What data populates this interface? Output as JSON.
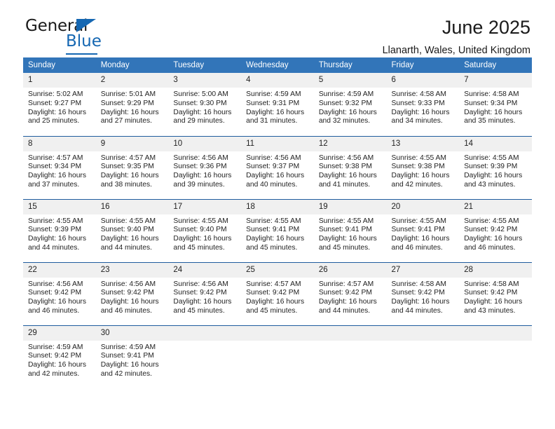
{
  "logo": {
    "word_one": "General",
    "word_two": "Blue",
    "icon": "triangle-icon"
  },
  "header": {
    "title": "June 2025",
    "location": "Llanarth, Wales, United Kingdom"
  },
  "calendar": {
    "weekday_headers": [
      "Sunday",
      "Monday",
      "Tuesday",
      "Wednesday",
      "Thursday",
      "Friday",
      "Saturday"
    ],
    "labels": {
      "sunrise": "Sunrise:",
      "sunset": "Sunset:",
      "daylight": "Daylight:"
    },
    "colors": {
      "header_background": "#3275b9",
      "row_divider": "#1f5c9e",
      "day_number_background": "#f0f0f0",
      "text": "#222222",
      "brand_blue": "#1567b2"
    },
    "weeks": [
      [
        {
          "day": "1",
          "sunrise": "Sunrise: 5:02 AM",
          "sunset": "Sunset: 9:27 PM",
          "daylight_line1": "Daylight: 16 hours",
          "daylight_line2": "and 25 minutes."
        },
        {
          "day": "2",
          "sunrise": "Sunrise: 5:01 AM",
          "sunset": "Sunset: 9:29 PM",
          "daylight_line1": "Daylight: 16 hours",
          "daylight_line2": "and 27 minutes."
        },
        {
          "day": "3",
          "sunrise": "Sunrise: 5:00 AM",
          "sunset": "Sunset: 9:30 PM",
          "daylight_line1": "Daylight: 16 hours",
          "daylight_line2": "and 29 minutes."
        },
        {
          "day": "4",
          "sunrise": "Sunrise: 4:59 AM",
          "sunset": "Sunset: 9:31 PM",
          "daylight_line1": "Daylight: 16 hours",
          "daylight_line2": "and 31 minutes."
        },
        {
          "day": "5",
          "sunrise": "Sunrise: 4:59 AM",
          "sunset": "Sunset: 9:32 PM",
          "daylight_line1": "Daylight: 16 hours",
          "daylight_line2": "and 32 minutes."
        },
        {
          "day": "6",
          "sunrise": "Sunrise: 4:58 AM",
          "sunset": "Sunset: 9:33 PM",
          "daylight_line1": "Daylight: 16 hours",
          "daylight_line2": "and 34 minutes."
        },
        {
          "day": "7",
          "sunrise": "Sunrise: 4:58 AM",
          "sunset": "Sunset: 9:34 PM",
          "daylight_line1": "Daylight: 16 hours",
          "daylight_line2": "and 35 minutes."
        }
      ],
      [
        {
          "day": "8",
          "sunrise": "Sunrise: 4:57 AM",
          "sunset": "Sunset: 9:34 PM",
          "daylight_line1": "Daylight: 16 hours",
          "daylight_line2": "and 37 minutes."
        },
        {
          "day": "9",
          "sunrise": "Sunrise: 4:57 AM",
          "sunset": "Sunset: 9:35 PM",
          "daylight_line1": "Daylight: 16 hours",
          "daylight_line2": "and 38 minutes."
        },
        {
          "day": "10",
          "sunrise": "Sunrise: 4:56 AM",
          "sunset": "Sunset: 9:36 PM",
          "daylight_line1": "Daylight: 16 hours",
          "daylight_line2": "and 39 minutes."
        },
        {
          "day": "11",
          "sunrise": "Sunrise: 4:56 AM",
          "sunset": "Sunset: 9:37 PM",
          "daylight_line1": "Daylight: 16 hours",
          "daylight_line2": "and 40 minutes."
        },
        {
          "day": "12",
          "sunrise": "Sunrise: 4:56 AM",
          "sunset": "Sunset: 9:38 PM",
          "daylight_line1": "Daylight: 16 hours",
          "daylight_line2": "and 41 minutes."
        },
        {
          "day": "13",
          "sunrise": "Sunrise: 4:55 AM",
          "sunset": "Sunset: 9:38 PM",
          "daylight_line1": "Daylight: 16 hours",
          "daylight_line2": "and 42 minutes."
        },
        {
          "day": "14",
          "sunrise": "Sunrise: 4:55 AM",
          "sunset": "Sunset: 9:39 PM",
          "daylight_line1": "Daylight: 16 hours",
          "daylight_line2": "and 43 minutes."
        }
      ],
      [
        {
          "day": "15",
          "sunrise": "Sunrise: 4:55 AM",
          "sunset": "Sunset: 9:39 PM",
          "daylight_line1": "Daylight: 16 hours",
          "daylight_line2": "and 44 minutes."
        },
        {
          "day": "16",
          "sunrise": "Sunrise: 4:55 AM",
          "sunset": "Sunset: 9:40 PM",
          "daylight_line1": "Daylight: 16 hours",
          "daylight_line2": "and 44 minutes."
        },
        {
          "day": "17",
          "sunrise": "Sunrise: 4:55 AM",
          "sunset": "Sunset: 9:40 PM",
          "daylight_line1": "Daylight: 16 hours",
          "daylight_line2": "and 45 minutes."
        },
        {
          "day": "18",
          "sunrise": "Sunrise: 4:55 AM",
          "sunset": "Sunset: 9:41 PM",
          "daylight_line1": "Daylight: 16 hours",
          "daylight_line2": "and 45 minutes."
        },
        {
          "day": "19",
          "sunrise": "Sunrise: 4:55 AM",
          "sunset": "Sunset: 9:41 PM",
          "daylight_line1": "Daylight: 16 hours",
          "daylight_line2": "and 45 minutes."
        },
        {
          "day": "20",
          "sunrise": "Sunrise: 4:55 AM",
          "sunset": "Sunset: 9:41 PM",
          "daylight_line1": "Daylight: 16 hours",
          "daylight_line2": "and 46 minutes."
        },
        {
          "day": "21",
          "sunrise": "Sunrise: 4:55 AM",
          "sunset": "Sunset: 9:42 PM",
          "daylight_line1": "Daylight: 16 hours",
          "daylight_line2": "and 46 minutes."
        }
      ],
      [
        {
          "day": "22",
          "sunrise": "Sunrise: 4:56 AM",
          "sunset": "Sunset: 9:42 PM",
          "daylight_line1": "Daylight: 16 hours",
          "daylight_line2": "and 46 minutes."
        },
        {
          "day": "23",
          "sunrise": "Sunrise: 4:56 AM",
          "sunset": "Sunset: 9:42 PM",
          "daylight_line1": "Daylight: 16 hours",
          "daylight_line2": "and 46 minutes."
        },
        {
          "day": "24",
          "sunrise": "Sunrise: 4:56 AM",
          "sunset": "Sunset: 9:42 PM",
          "daylight_line1": "Daylight: 16 hours",
          "daylight_line2": "and 45 minutes."
        },
        {
          "day": "25",
          "sunrise": "Sunrise: 4:57 AM",
          "sunset": "Sunset: 9:42 PM",
          "daylight_line1": "Daylight: 16 hours",
          "daylight_line2": "and 45 minutes."
        },
        {
          "day": "26",
          "sunrise": "Sunrise: 4:57 AM",
          "sunset": "Sunset: 9:42 PM",
          "daylight_line1": "Daylight: 16 hours",
          "daylight_line2": "and 44 minutes."
        },
        {
          "day": "27",
          "sunrise": "Sunrise: 4:58 AM",
          "sunset": "Sunset: 9:42 PM",
          "daylight_line1": "Daylight: 16 hours",
          "daylight_line2": "and 44 minutes."
        },
        {
          "day": "28",
          "sunrise": "Sunrise: 4:58 AM",
          "sunset": "Sunset: 9:42 PM",
          "daylight_line1": "Daylight: 16 hours",
          "daylight_line2": "and 43 minutes."
        }
      ],
      [
        {
          "day": "29",
          "sunrise": "Sunrise: 4:59 AM",
          "sunset": "Sunset: 9:42 PM",
          "daylight_line1": "Daylight: 16 hours",
          "daylight_line2": "and 42 minutes."
        },
        {
          "day": "30",
          "sunrise": "Sunrise: 4:59 AM",
          "sunset": "Sunset: 9:41 PM",
          "daylight_line1": "Daylight: 16 hours",
          "daylight_line2": "and 42 minutes."
        },
        {
          "day": "",
          "sunrise": "",
          "sunset": "",
          "daylight_line1": "",
          "daylight_line2": ""
        },
        {
          "day": "",
          "sunrise": "",
          "sunset": "",
          "daylight_line1": "",
          "daylight_line2": ""
        },
        {
          "day": "",
          "sunrise": "",
          "sunset": "",
          "daylight_line1": "",
          "daylight_line2": ""
        },
        {
          "day": "",
          "sunrise": "",
          "sunset": "",
          "daylight_line1": "",
          "daylight_line2": ""
        },
        {
          "day": "",
          "sunrise": "",
          "sunset": "",
          "daylight_line1": "",
          "daylight_line2": ""
        }
      ]
    ]
  }
}
